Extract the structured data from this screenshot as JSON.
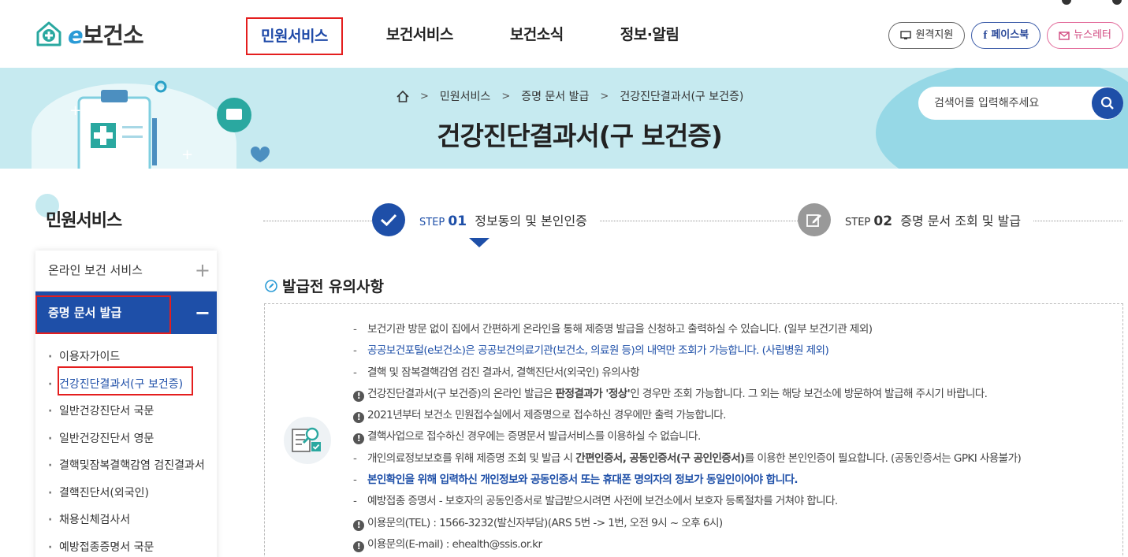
{
  "header": {
    "logo_text": "보건소",
    "logo_prefix": "e",
    "gnb": [
      "민원서비스",
      "보건서비스",
      "보건소식",
      "정보·알림"
    ],
    "util": {
      "remote": "원격지원",
      "facebook": "페이스북",
      "newsletter": "뉴스레터"
    }
  },
  "banner": {
    "breadcrumb": [
      "민원서비스",
      "증명 문서 발급",
      "건강진단결과서(구 보건증)"
    ],
    "title": "건강진단결과서(구 보건증)",
    "search_placeholder": "검색어를 입력해주세요"
  },
  "sidebar": {
    "title": "민원서비스",
    "items": [
      "온라인 보건 서비스",
      "증명 문서 발급"
    ],
    "sub_items": [
      "이용자가이드",
      "건강진단결과서(구 보건증)",
      "일반건강진단서 국문",
      "일반건강진단서 영문",
      "결핵및잠복결핵감염 검진결과서",
      "결핵진단서(외국인)",
      "채용신체검사서",
      "예방접종증명서 국문"
    ]
  },
  "steps": [
    {
      "prefix": "STEP",
      "num": "01",
      "label": "정보동의 및 본인인증"
    },
    {
      "prefix": "STEP",
      "num": "02",
      "label": "증명 문서 조회 및 발급"
    }
  ],
  "notice": {
    "title": "발급전 유의사항",
    "lines": [
      "보건기관 방문 없이 집에서 간편하게 온라인을 통해 제증명 발급을 신청하고 출력하실 수 있습니다. (일부 보건기관 제외)",
      "공공보건포털(e보건소)은 공공보건의료기관(보건소, 의료원 등)의 내역만 조회가 가능합니다. (사립병원 제외)",
      "결핵 및 잠복결핵감염 검진 결과서, 결핵진단서(외국인) 유의사항",
      "건강진단결과서(구 보건증)의 온라인 발급은 ",
      "판정결과가 '정상'",
      "인 경우만 조회 가능합니다. 그 외는 해당 보건소에 방문하여 발급해 주시기 바랍니다.",
      "2021년부터 보건소 민원접수실에서 제증명으로 접수하신 경우에만 출력 가능합니다.",
      "결핵사업으로 접수하신 경우에는 증명문서 발급서비스를 이용하실 수 없습니다.",
      "개인의료정보보호를 위해 제증명 조회 및 발급 시 ",
      "간편인증서, 공동인증서(구 공인인증서)",
      "를 이용한 본인인증이 필요합니다. (공동인증서는 GPKI 사용불가)",
      "본인확인을 위해 입력하신 개인정보와 공동인증서 또는 휴대폰 명의자의 정보가 동일인이어야 합니다.",
      "예방접종 증명서 - 보호자의 공동인증서로 발급받으시려면 사전에 보건소에서 보호자 등록절차를 거쳐야 합니다.",
      "이용문의(TEL) : 1566-3232(발신자부담)(ARS 5번 -> 1번, 오전 9시 ~ 오후 6시)",
      "이용문의(E-mail) : ehealth@ssis.or.kr"
    ]
  },
  "colors": {
    "primary": "#1e4fa8",
    "banner_bg": "#c6eaf0",
    "highlight": "#e41e1e"
  }
}
